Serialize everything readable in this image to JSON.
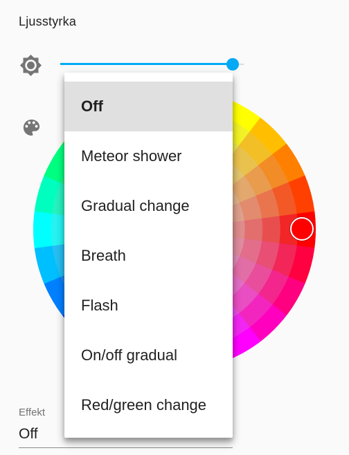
{
  "brightness": {
    "label": "Ljusstyrka",
    "icon": "brightness-sun-icon",
    "value_fraction": 0.94,
    "accent_color": "#03a9f4"
  },
  "color": {
    "icon": "palette-icon",
    "selected_color": "#ff0000"
  },
  "effect": {
    "label": "Effekt",
    "value": "Off"
  },
  "dropdown": {
    "selected_index": 0,
    "options": [
      {
        "label": "Off"
      },
      {
        "label": "Meteor shower"
      },
      {
        "label": "Gradual change"
      },
      {
        "label": "Breath"
      },
      {
        "label": "Flash"
      },
      {
        "label": "On/off gradual"
      },
      {
        "label": "Red/green change"
      }
    ]
  }
}
